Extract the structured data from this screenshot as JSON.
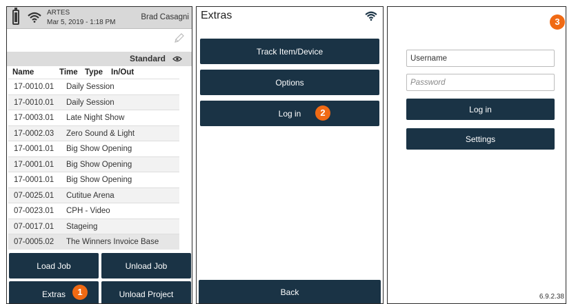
{
  "panel1": {
    "app_name": "ARTES",
    "datetime": "Mar 5, 2019 - 1:18 PM",
    "user": "Brad Casagni",
    "view_label": "Standard",
    "columns": [
      "Name",
      "Time",
      "Type",
      "In/Out"
    ],
    "rows": [
      {
        "num": "17-0010.01",
        "name": "Daily Session"
      },
      {
        "num": "17-0010.01",
        "name": "Daily Session"
      },
      {
        "num": "17-0003.01",
        "name": "Late Night Show"
      },
      {
        "num": "17-0002.03",
        "name": "Zero Sound & Light"
      },
      {
        "num": "17-0001.01",
        "name": "Big Show Opening"
      },
      {
        "num": "17-0001.01",
        "name": "Big Show Opening"
      },
      {
        "num": "17-0001.01",
        "name": "Big Show Opening"
      },
      {
        "num": "07-0025.01",
        "name": "Cutitue Arena"
      },
      {
        "num": "07-0023.01",
        "name": "CPH - Video"
      },
      {
        "num": "07-0017.01",
        "name": "Stageing"
      },
      {
        "num": "07-0005.02",
        "name": "The Winners Invoice Base"
      }
    ],
    "buttons": {
      "load_job": "Load Job",
      "unload_job": "Unload Job",
      "extras": "Extras",
      "unload_project": "Unload Project"
    },
    "badge": "1"
  },
  "panel2": {
    "title": "Extras",
    "buttons": {
      "track": "Track Item/Device",
      "options": "Options",
      "login": "Log in",
      "back": "Back"
    },
    "badge": "2"
  },
  "panel3": {
    "username_value": "Username",
    "password_placeholder": "Password",
    "login": "Log in",
    "settings": "Settings",
    "version": "6.9.2.38",
    "badge": "3"
  },
  "colors": {
    "button": "#1a3345",
    "badge": "#f06a14",
    "header": "#d8d8d8"
  }
}
